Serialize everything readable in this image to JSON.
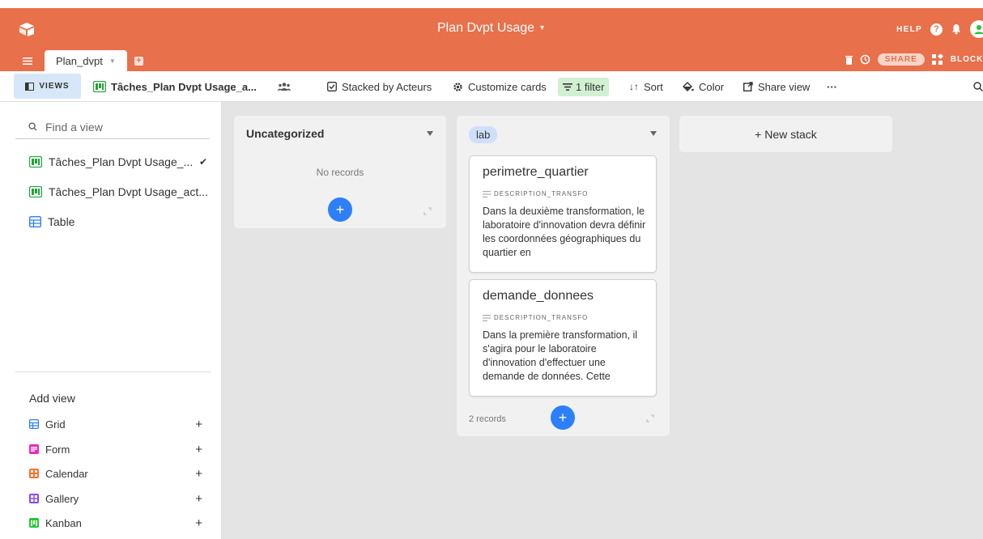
{
  "header": {
    "base_title": "Plan Dvpt Usage",
    "help_label": "HELP",
    "accent_color": "#e8704a"
  },
  "tabs": {
    "active_tab": "Plan_dvpt",
    "share_label": "SHARE",
    "blocks_label": "BLOCKS"
  },
  "viewbar": {
    "views_label": "VIEWS",
    "view_title": "Tâches_Plan Dvpt Usage_a...",
    "stacked_by": "Stacked by Acteurs",
    "customize": "Customize cards",
    "filter": "1 filter",
    "sort": "Sort",
    "color": "Color",
    "share_view": "Share view",
    "more": "···"
  },
  "sidebar": {
    "search_placeholder": "Find a view",
    "views": [
      {
        "label": "Tâches_Plan Dvpt Usage_...",
        "icon": "kanban-icon",
        "selected": true
      },
      {
        "label": "Tâches_Plan Dvpt Usage_act...",
        "icon": "kanban-icon",
        "selected": false
      },
      {
        "label": "Table",
        "icon": "grid-icon",
        "selected": false
      }
    ],
    "add_view_label": "Add view",
    "add_items": [
      {
        "label": "Grid",
        "color": "#2d7ff9"
      },
      {
        "label": "Form",
        "color": "#e929ba"
      },
      {
        "label": "Calendar",
        "color": "#ff6f2c"
      },
      {
        "label": "Gallery",
        "color": "#8b46ff"
      },
      {
        "label": "Kanban",
        "color": "#20c933"
      }
    ]
  },
  "board": {
    "stacks": [
      {
        "title": "Uncategorized",
        "empty_text": "No records"
      },
      {
        "title": "lab",
        "records_count": "2 records",
        "cards": [
          {
            "title": "perimetre_quartier",
            "field": "DESCRIPTION_TRANSFO",
            "desc": "Dans la deuxième transformation, le laboratoire d'innovation devra définir les coordonnées géographiques du quartier en"
          },
          {
            "title": "demande_donnees",
            "field": "DESCRIPTION_TRANSFO",
            "desc": "Dans la première transformation, il s'agira pour le laboratoire d'innovation d'effectuer une demande de données. Cette"
          }
        ]
      }
    ],
    "new_stack_label": "+ New stack"
  }
}
